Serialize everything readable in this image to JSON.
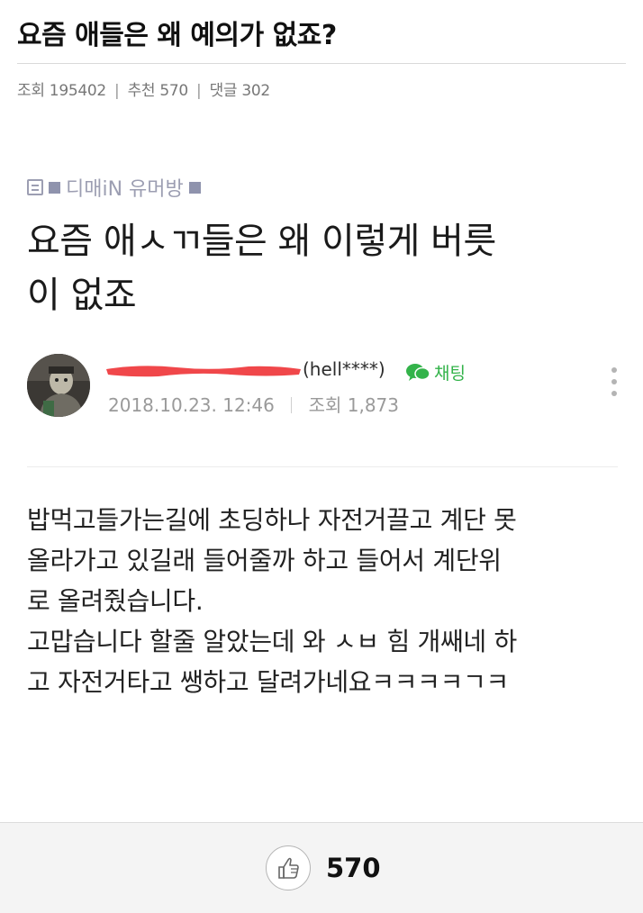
{
  "post": {
    "title": "요즘 애들은 왜 예의가 없죠?",
    "meta": {
      "views_label": "조회",
      "views": "195402",
      "recommend_label": "추천",
      "recommend": "570",
      "comments_label": "댓글",
      "comments": "302"
    }
  },
  "embed": {
    "cafe_name": "디매iN 유머방",
    "title_lines": [
      "요즘 애ㅅㄲ들은 왜 이렇게 버릇",
      "이 없죠"
    ],
    "author_handle": "(hell****)",
    "chat_label": "채팅",
    "date": "2018.10.23. 12:46",
    "views": "조회 1,873",
    "body_lines": [
      "밥먹고들가는길에 초딩하나 자전거끌고 계단 못",
      "올라가고 있길래 들어줄까 하고 들어서 계단위",
      "로 올려줬습니다.",
      "고맙습니다 할줄 알았는데 와 ㅅㅂ 힘 개쌔네 하",
      "고 자전거타고 쌩하고 달려가네요ㅋㅋㅋㅋㄱㅋ"
    ]
  },
  "footer": {
    "like_count": "570",
    "like_icon": "thumbs-up-icon"
  },
  "colors": {
    "cafe": "#9c9eb2",
    "chat": "#33b34a",
    "redaction": "#f0474a"
  }
}
